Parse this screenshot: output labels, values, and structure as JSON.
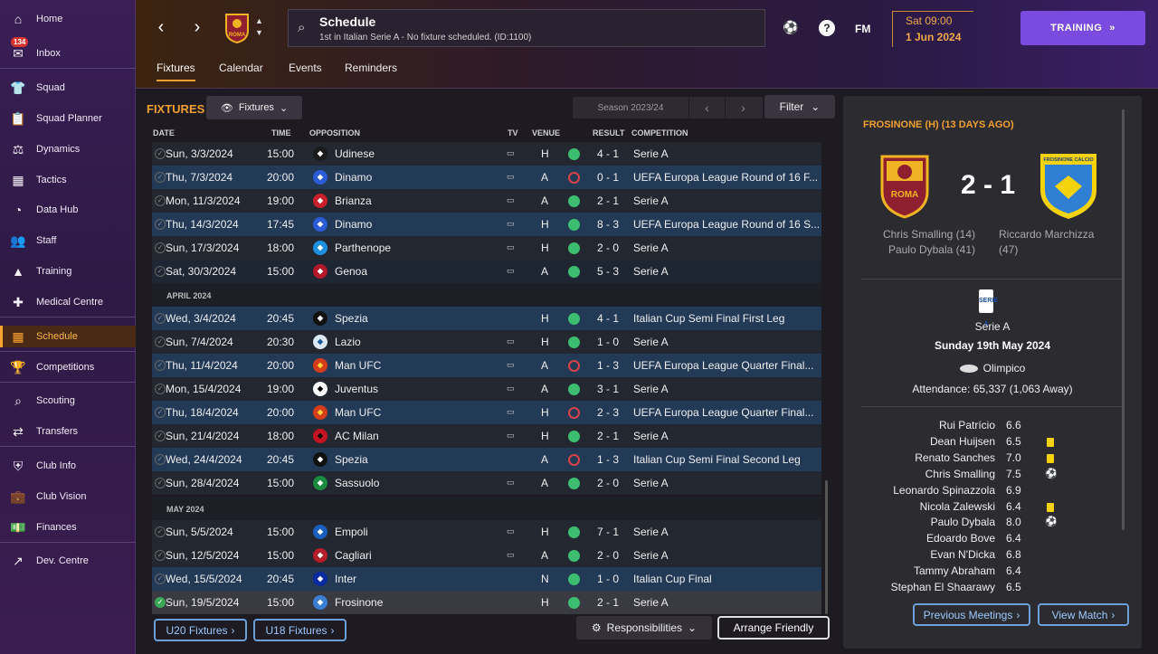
{
  "sidebar": {
    "inbox_count": "134",
    "items": [
      {
        "label": "Home",
        "icon": "home-icon"
      },
      {
        "label": "Inbox",
        "icon": "mail-icon"
      },
      {
        "label": "Squad",
        "icon": "shirt-icon"
      },
      {
        "label": "Squad Planner",
        "icon": "clipboard-icon"
      },
      {
        "label": "Dynamics",
        "icon": "dynamics-icon"
      },
      {
        "label": "Tactics",
        "icon": "tactics-icon"
      },
      {
        "label": "Data Hub",
        "icon": "data-hub-icon"
      },
      {
        "label": "Staff",
        "icon": "staff-icon"
      },
      {
        "label": "Training",
        "icon": "cone-icon"
      },
      {
        "label": "Medical Centre",
        "icon": "medical-icon"
      },
      {
        "label": "Schedule",
        "icon": "calendar-icon"
      },
      {
        "label": "Competitions",
        "icon": "trophy-icon"
      },
      {
        "label": "Scouting",
        "icon": "magnifier-icon"
      },
      {
        "label": "Transfers",
        "icon": "transfer-icon"
      },
      {
        "label": "Club Info",
        "icon": "shield-icon"
      },
      {
        "label": "Club Vision",
        "icon": "briefcase-icon"
      },
      {
        "label": "Finances",
        "icon": "money-icon"
      },
      {
        "label": "Dev. Centre",
        "icon": "growth-icon"
      }
    ]
  },
  "header": {
    "title": "Schedule",
    "subtitle": "1st in Italian Serie A - No fixture scheduled. (ID:1100)",
    "club_crest_text": "ROMA",
    "fm_label": "FM",
    "date_time": "Sat 09:00",
    "date": "1 Jun 2024",
    "continue_label": "TRAINING",
    "tabs": [
      "Fixtures",
      "Calendar",
      "Events",
      "Reminders"
    ]
  },
  "fixtures": {
    "heading": "FIXTURES",
    "view_dropdown": "Fixtures",
    "season": "Season 2023/24",
    "filter_label": "Filter",
    "columns": {
      "date": "DATE",
      "time": "TIME",
      "opposition": "OPPOSITION",
      "tv": "TV",
      "venue": "VENUE",
      "result": "RESULT",
      "competition": "COMPETITION"
    },
    "april_label": "APRIL 2024",
    "may_label": "MAY 2024",
    "rows": [
      {
        "date": "Sun, 3/3/2024",
        "time": "15:00",
        "opp": "Udinese",
        "venue": "H",
        "result": "4 - 1",
        "comp": "Serie A",
        "win": true,
        "tv": true,
        "style": "even",
        "badge": "#1b1b1b",
        "fg": "#fff"
      },
      {
        "date": "Thu, 7/3/2024",
        "time": "20:00",
        "opp": "Dinamo",
        "venue": "A",
        "result": "0 - 1",
        "comp": "UEFA Europa League Round of 16  F...",
        "win": false,
        "tv": true,
        "style": "euro",
        "badge": "#2b5bd7",
        "fg": "#fff"
      },
      {
        "date": "Mon, 11/3/2024",
        "time": "19:00",
        "opp": "Brianza",
        "venue": "A",
        "result": "2 - 1",
        "comp": "Serie A",
        "win": true,
        "tv": true,
        "style": "even",
        "badge": "#c8202a",
        "fg": "#fff"
      },
      {
        "date": "Thu, 14/3/2024",
        "time": "17:45",
        "opp": "Dinamo",
        "venue": "H",
        "result": "8 - 3",
        "comp": "UEFA Europa League Round of 16  S...",
        "win": true,
        "tv": true,
        "style": "euro",
        "badge": "#2b5bd7",
        "fg": "#fff"
      },
      {
        "date": "Sun, 17/3/2024",
        "time": "18:00",
        "opp": "Parthenope",
        "venue": "H",
        "result": "2 - 0",
        "comp": "Serie A",
        "win": true,
        "tv": true,
        "style": "even",
        "badge": "#1d8fe0",
        "fg": "#fff"
      },
      {
        "date": "Sat, 30/3/2024",
        "time": "15:00",
        "opp": "Genoa",
        "venue": "A",
        "result": "5 - 3",
        "comp": "Serie A",
        "win": true,
        "tv": true,
        "style": "odd",
        "badge": "#b3182a",
        "fg": "#fff"
      },
      {
        "date": "Wed, 3/4/2024",
        "time": "20:45",
        "opp": "Spezia",
        "venue": "H",
        "result": "4 - 1",
        "comp": "Italian Cup Semi Final First Leg",
        "win": true,
        "tv": false,
        "style": "euro",
        "badge": "#111",
        "fg": "#fff"
      },
      {
        "date": "Sun, 7/4/2024",
        "time": "20:30",
        "opp": "Lazio",
        "venue": "H",
        "result": "1 - 0",
        "comp": "Serie A",
        "win": true,
        "tv": true,
        "style": "even",
        "badge": "#dbe8f4",
        "fg": "#1b5a9a"
      },
      {
        "date": "Thu, 11/4/2024",
        "time": "20:00",
        "opp": "Man UFC",
        "venue": "A",
        "result": "1 - 3",
        "comp": "UEFA Europa League Quarter Final...",
        "win": false,
        "tv": true,
        "style": "euro",
        "badge": "#d43d1b",
        "fg": "#ffd43a"
      },
      {
        "date": "Mon, 15/4/2024",
        "time": "19:00",
        "opp": "Juventus",
        "venue": "A",
        "result": "3 - 1",
        "comp": "Serie A",
        "win": true,
        "tv": true,
        "style": "even",
        "badge": "#ffffff",
        "fg": "#000"
      },
      {
        "date": "Thu, 18/4/2024",
        "time": "20:00",
        "opp": "Man UFC",
        "venue": "H",
        "result": "2 - 3",
        "comp": "UEFA Europa League Quarter Final...",
        "win": false,
        "tv": true,
        "style": "euro",
        "badge": "#d43d1b",
        "fg": "#ffd43a"
      },
      {
        "date": "Sun, 21/4/2024",
        "time": "18:00",
        "opp": "AC Milan",
        "venue": "H",
        "result": "2 - 1",
        "comp": "Serie A",
        "win": true,
        "tv": true,
        "style": "even",
        "badge": "#c41424",
        "fg": "#000"
      },
      {
        "date": "Wed, 24/4/2024",
        "time": "20:45",
        "opp": "Spezia",
        "venue": "A",
        "result": "1 - 3",
        "comp": "Italian Cup Semi Final Second Leg",
        "win": false,
        "tv": false,
        "style": "euro",
        "badge": "#111",
        "fg": "#fff"
      },
      {
        "date": "Sun, 28/4/2024",
        "time": "15:00",
        "opp": "Sassuolo",
        "venue": "A",
        "result": "2 - 0",
        "comp": "Serie A",
        "win": true,
        "tv": true,
        "style": "even",
        "badge": "#1a8a3e",
        "fg": "#fff"
      },
      {
        "date": "Sun, 5/5/2024",
        "time": "15:00",
        "opp": "Empoli",
        "venue": "H",
        "result": "7 - 1",
        "comp": "Serie A",
        "win": true,
        "tv": true,
        "style": "even",
        "badge": "#1a5fc0",
        "fg": "#fff"
      },
      {
        "date": "Sun, 12/5/2024",
        "time": "15:00",
        "opp": "Cagliari",
        "venue": "A",
        "result": "2 - 0",
        "comp": "Serie A",
        "win": true,
        "tv": true,
        "style": "even",
        "badge": "#b61d2a",
        "fg": "#fff"
      },
      {
        "date": "Wed, 15/5/2024",
        "time": "20:45",
        "opp": "Inter",
        "venue": "N",
        "result": "1 - 0",
        "comp": "Italian Cup Final",
        "win": true,
        "tv": false,
        "style": "euro",
        "badge": "#0a2aa0",
        "fg": "#fff"
      },
      {
        "date": "Sun, 19/5/2024",
        "time": "15:00",
        "opp": "Frosinone",
        "venue": "H",
        "result": "2 - 1",
        "comp": "Serie A",
        "win": true,
        "tv": false,
        "style": "sel",
        "badge": "#3b7fd4",
        "fg": "#fff"
      }
    ],
    "u20_label": "U20 Fixtures",
    "u18_label": "U18 Fixtures",
    "responsibilities_label": "Responsibilities",
    "arrange_label": "Arrange Friendly"
  },
  "match": {
    "heading": "FROSINONE (H) (13 DAYS AGO)",
    "home_crest": "ROMA",
    "away_crest": "FROSINONE CALCIO",
    "score": "2 - 1",
    "home_scorers": [
      "Chris Smalling (14)",
      "Paulo Dybala (41)"
    ],
    "away_scorers": [
      "Riccardo Marchizza",
      "(47)"
    ],
    "competition": "Serie A",
    "comp_icon_text": "SERIE A",
    "date": "Sunday 19th May 2024",
    "venue": "Olimpico",
    "attendance": "Attendance: 65,337 (1,063 Away)",
    "players": [
      {
        "name": "Rui Patrício",
        "rating": "6.6",
        "event": ""
      },
      {
        "name": "Dean Huijsen",
        "rating": "6.5",
        "event": "yellow"
      },
      {
        "name": "Renato Sanches",
        "rating": "7.0",
        "event": "yellow"
      },
      {
        "name": "Chris Smalling",
        "rating": "7.5",
        "event": "goal"
      },
      {
        "name": "Leonardo Spinazzola",
        "rating": "6.9",
        "event": ""
      },
      {
        "name": "Nicola Zalewski",
        "rating": "6.4",
        "event": "yellow"
      },
      {
        "name": "Paulo Dybala",
        "rating": "8.0",
        "event": "goal"
      },
      {
        "name": "Edoardo Bove",
        "rating": "6.4",
        "event": ""
      },
      {
        "name": "Evan N'Dicka",
        "rating": "6.8",
        "event": ""
      },
      {
        "name": "Tammy Abraham",
        "rating": "6.4",
        "event": ""
      },
      {
        "name": "Stephan El Shaarawy",
        "rating": "6.5",
        "event": ""
      }
    ],
    "prev_label": "Previous Meetings",
    "view_label": "View Match"
  }
}
